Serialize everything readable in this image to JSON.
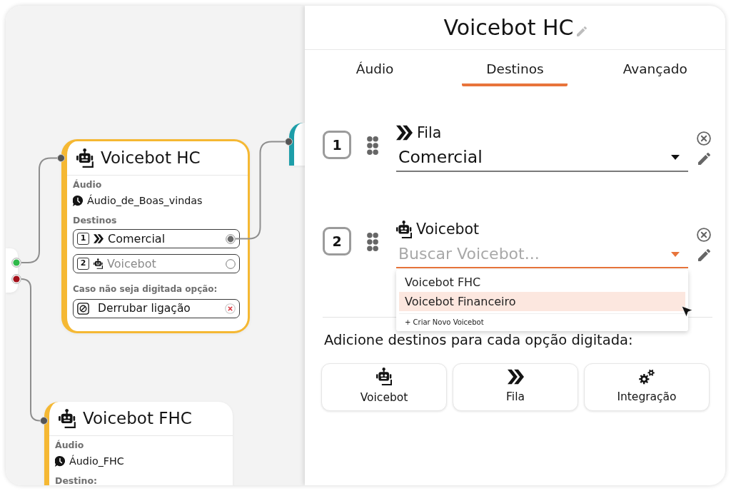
{
  "canvas": {
    "start_ports": [
      {
        "color": "#2fb84a"
      },
      {
        "color": "#a3101a"
      }
    ],
    "nodes": [
      {
        "color": "#f5b833",
        "selected": true,
        "title": "Voicebot HC",
        "audio_label": "Áudio",
        "audio": "Áudio_de_Boas_vindas",
        "destinations_label": "Destinos",
        "destinations": [
          {
            "number": "1",
            "kind": "fila",
            "name": "Comercial",
            "connected": true
          },
          {
            "number": "2",
            "kind": "voicebot",
            "name": "Voicebot",
            "connected": false
          }
        ],
        "fallback_label": "Caso não seja digitada opção:",
        "fallback": "Derrubar ligação"
      },
      {
        "color": "#f5b833",
        "selected": false,
        "title": "Voicebot FHC",
        "audio_label": "Áudio",
        "audio": "Áudio_FHC",
        "destinations_label": "Destino:"
      },
      {
        "color": "#1e9ea9",
        "selected": false
      }
    ]
  },
  "panel": {
    "title": "Voicebot HC",
    "tabs": [
      {
        "label": "Áudio",
        "selected": false
      },
      {
        "label": "Destinos",
        "selected": true
      },
      {
        "label": "Avançado",
        "selected": false
      }
    ],
    "destinations": [
      {
        "number": "1",
        "kind": "fila",
        "type_label": "Fila",
        "value": "Comercial",
        "focused": false
      },
      {
        "number": "2",
        "kind": "voicebot",
        "type_label": "Voicebot",
        "placeholder": "Buscar Voicebot...",
        "focused": true,
        "expanded": true,
        "options": [
          {
            "label": "Voicebot FHC",
            "selected": false
          },
          {
            "label": "Voicebot Financeiro",
            "selected": true
          }
        ],
        "create_label": "+ Criar Novo Voicebot"
      }
    ],
    "add_prompt": "Adicione destinos para cada opção digitada:",
    "add_buttons": [
      {
        "kind": "voicebot",
        "label": "Voicebot"
      },
      {
        "kind": "fila",
        "label": "Fila"
      },
      {
        "kind": "integracao",
        "label": "Integração"
      }
    ]
  }
}
